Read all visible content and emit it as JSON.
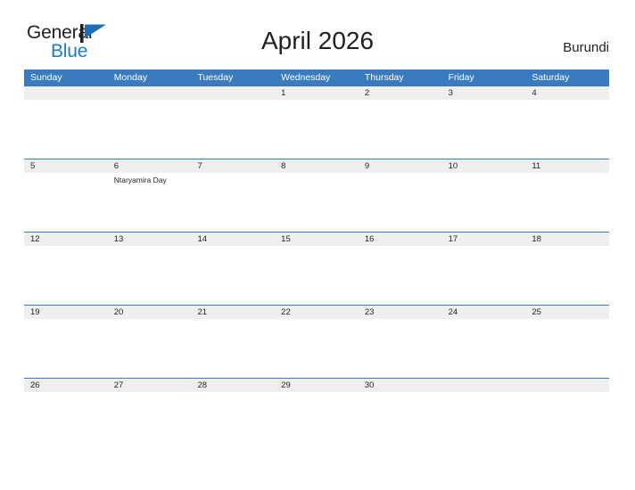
{
  "logo": {
    "word1": "General",
    "word2": "Blue",
    "flag_icon": "blue-triangle-flag-icon",
    "brand_blue": "#1e7cc4",
    "brand_dark": "#231f20"
  },
  "header": {
    "title": "April 2026",
    "country": "Burundi"
  },
  "colors": {
    "weekday_header_bg": "#3a7bbf",
    "weekday_header_text": "#ffffff",
    "day_strip_bg": "#efefef",
    "row_separator": "#3a7bbf",
    "text": "#231f20",
    "page_bg": "#ffffff"
  },
  "calendar": {
    "month": "April",
    "year": "2026",
    "weekdays": [
      "Sunday",
      "Monday",
      "Tuesday",
      "Wednesday",
      "Thursday",
      "Friday",
      "Saturday"
    ],
    "weeks": [
      [
        {
          "day": "",
          "events": []
        },
        {
          "day": "",
          "events": []
        },
        {
          "day": "",
          "events": []
        },
        {
          "day": "1",
          "events": []
        },
        {
          "day": "2",
          "events": []
        },
        {
          "day": "3",
          "events": []
        },
        {
          "day": "4",
          "events": []
        }
      ],
      [
        {
          "day": "5",
          "events": []
        },
        {
          "day": "6",
          "events": [
            "Ntaryamira Day"
          ]
        },
        {
          "day": "7",
          "events": []
        },
        {
          "day": "8",
          "events": []
        },
        {
          "day": "9",
          "events": []
        },
        {
          "day": "10",
          "events": []
        },
        {
          "day": "11",
          "events": []
        }
      ],
      [
        {
          "day": "12",
          "events": []
        },
        {
          "day": "13",
          "events": []
        },
        {
          "day": "14",
          "events": []
        },
        {
          "day": "15",
          "events": []
        },
        {
          "day": "16",
          "events": []
        },
        {
          "day": "17",
          "events": []
        },
        {
          "day": "18",
          "events": []
        }
      ],
      [
        {
          "day": "19",
          "events": []
        },
        {
          "day": "20",
          "events": []
        },
        {
          "day": "21",
          "events": []
        },
        {
          "day": "22",
          "events": []
        },
        {
          "day": "23",
          "events": []
        },
        {
          "day": "24",
          "events": []
        },
        {
          "day": "25",
          "events": []
        }
      ],
      [
        {
          "day": "26",
          "events": []
        },
        {
          "day": "27",
          "events": []
        },
        {
          "day": "28",
          "events": []
        },
        {
          "day": "29",
          "events": []
        },
        {
          "day": "30",
          "events": []
        },
        {
          "day": "",
          "events": []
        },
        {
          "day": "",
          "events": []
        }
      ]
    ]
  }
}
